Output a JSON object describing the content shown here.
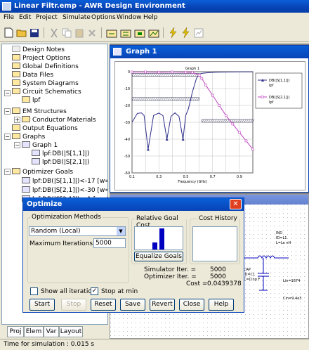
{
  "window": {
    "title": "Linear Filtr.emp - AWR Design Environment"
  },
  "menu": [
    "File",
    "Edit",
    "Project",
    "Simulate",
    "Options",
    "Window",
    "Help"
  ],
  "tree": [
    {
      "label": "Design Notes"
    },
    {
      "label": "Project Options"
    },
    {
      "label": "Global Definitions"
    },
    {
      "label": "Data Files"
    },
    {
      "label": "System Diagrams"
    },
    {
      "label": "Circuit Schematics"
    },
    {
      "label": "lpf"
    },
    {
      "label": "EM Structures"
    },
    {
      "label": "Conductor Materials"
    },
    {
      "label": "Output Equations"
    },
    {
      "label": "Graphs"
    },
    {
      "label": "Graph 1"
    },
    {
      "label": "lpf:DB(|S[1,1]|)"
    },
    {
      "label": "lpf:DB(|S[2,1]|)"
    },
    {
      "label": "Optimizer Goals"
    },
    {
      "label": "lpf:DB(|S[1,1]|)<-17 [w=1"
    },
    {
      "label": "lpf:DB(|S[2,1]|)<-30 [w=1"
    },
    {
      "label": "lpf:DB(|S[2,1]|)>-1 [w=1"
    }
  ],
  "tabs": [
    "Proj",
    "Elem",
    "Var",
    "Layout"
  ],
  "status": "Time for simulation : 0.015 s",
  "graph_window": {
    "title": "Graph 1"
  },
  "chart_data": {
    "type": "line",
    "title": "Graph 1",
    "xlabel": "Frequency (GHz)",
    "ylabel": "",
    "xlim": [
      0.1,
      1
    ],
    "ylim": [
      -60,
      0
    ],
    "x_ticks": [
      "0.1",
      "0.3",
      "0.5",
      "0.7",
      "0.9"
    ],
    "y_ticks": [
      "0",
      "-10",
      "-20",
      "-30",
      "-40",
      "-50",
      "-60"
    ],
    "legend": [
      {
        "name": "DB(|S[1,1]|)",
        "sub": "lpf"
      },
      {
        "name": "DB(|S[2,1]|)",
        "sub": "lpf"
      }
    ],
    "legend_position": "top-right",
    "grid": true,
    "series": [
      {
        "name": "DB(|S[1,1]|)",
        "color": "#2d2d8a",
        "x": [
          0.1,
          0.14,
          0.17,
          0.19,
          0.22,
          0.26,
          0.3,
          0.33,
          0.36,
          0.39,
          0.42,
          0.45,
          0.48,
          0.5,
          0.52,
          0.55,
          0.58,
          0.6,
          0.62,
          0.65,
          0.68,
          0.7,
          0.72,
          0.75,
          0.8,
          0.85,
          0.9,
          1.0
        ],
        "y": [
          -30,
          -24.7,
          -24.4,
          -26,
          -46,
          -26,
          -24.5,
          -26,
          -40,
          -26.5,
          -24.4,
          -26.5,
          -40,
          -26,
          -22,
          -12,
          -4,
          -1.5,
          -1,
          -0.7,
          -0.5,
          -0.4,
          -0.3,
          -0.25,
          -0.2,
          -0.15,
          -0.12,
          -0.1
        ]
      },
      {
        "name": "DB(|S[2,1]|)",
        "color": "#c040c0",
        "x": [
          0.1,
          0.2,
          0.3,
          0.4,
          0.5,
          0.55,
          0.6,
          0.62,
          0.65,
          0.7,
          0.75,
          0.8,
          0.85,
          0.9,
          0.95,
          1.0
        ],
        "y": [
          -0.2,
          -0.2,
          -0.3,
          -0.2,
          -0.3,
          -0.4,
          -2,
          -4,
          -8,
          -14,
          -20,
          -26,
          -31,
          -36,
          -41,
          -46
        ]
      }
    ],
    "goals": [
      {
        "label": "<-17",
        "x": [
          0.1,
          0.6
        ],
        "y": -17
      },
      {
        "label": ">-1",
        "x": [
          0.1,
          0.6
        ],
        "y": -1
      },
      {
        "label": "<-30",
        "x": [
          0.62,
          1.0
        ],
        "y": -30
      }
    ]
  },
  "optimize": {
    "title": "Optimize",
    "methods_label": "Optimization Methods",
    "method_value": "Random (Local)",
    "max_iter_label": "Maximum Iterations",
    "max_iter_value": "5000",
    "rel_cost_label": "Relative Goal Cost",
    "cost_history_label": "Cost History",
    "equalize_label": "Equalize Goals",
    "sim_iter_label": "Simulator Iter. =",
    "sim_iter_value": "5000",
    "opt_iter_label": "Optimizer Iter. =",
    "opt_iter_value": "5000",
    "cost_label": "Cost =",
    "cost_value": "0.0439378",
    "show_all_label": "Show all iteration",
    "stop_at_min_label": "Stop at min",
    "stop_at_min_checked": true,
    "show_all_checked": false,
    "buttons": [
      "Start",
      "Stop",
      "Reset",
      "Save",
      "Revert",
      "Close",
      "Help"
    ],
    "rel_bars": [
      0.35,
      1.0
    ]
  },
  "schematic": {
    "labels": [
      "IND",
      "ID=L1",
      "L=Lo nH",
      "CAP",
      "ID=C1",
      "C=Cinp F",
      "Lin=1674",
      "Cin=9.4e3"
    ]
  }
}
